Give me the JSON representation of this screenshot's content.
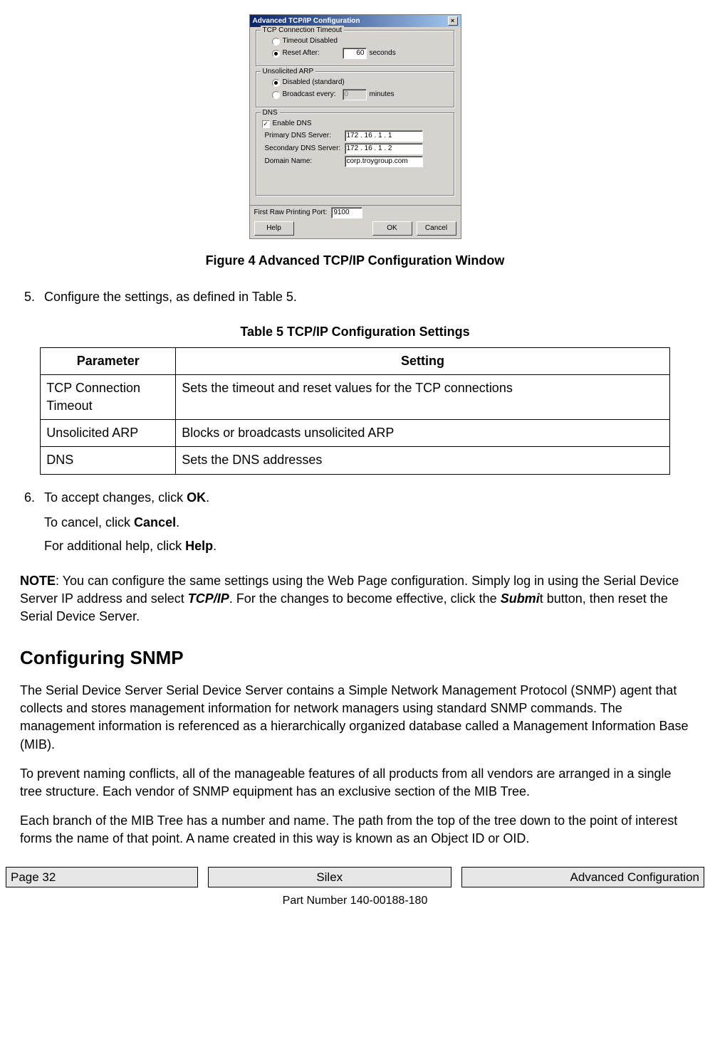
{
  "dialog": {
    "title": "Advanced TCP/IP Configuration",
    "tcpGroup": {
      "title": "TCP Connection Timeout",
      "opt1": "Timeout Disabled",
      "opt2": "Reset After:",
      "value": "60",
      "unit": "seconds"
    },
    "arpGroup": {
      "title": "Unsolicited ARP",
      "opt1": "Disabled (standard)",
      "opt2": "Broadcast every:",
      "value": "0",
      "unit": "minutes"
    },
    "dnsGroup": {
      "title": "DNS",
      "enable": "Enable DNS",
      "primaryLabel": "Primary DNS Server:",
      "primaryVal": "172 . 16 .  1  .  1",
      "secondaryLabel": "Secondary DNS Server:",
      "secondaryVal": "172 . 16 .  1  .  2",
      "domainLabel": "Domain Name:",
      "domainVal": "corp.troygroup.com"
    },
    "rawLabel": "First Raw Printing Port:",
    "rawVal": "9100",
    "helpBtn": "Help",
    "okBtn": "OK",
    "cancelBtn": "Cancel"
  },
  "fig": "Figure 4  Advanced TCP/IP Configuration Window",
  "step5": "Configure the settings, as defined in Table 5.",
  "tableCaption": "Table 5  TCP/IP Configuration Settings",
  "table": {
    "h1": "Parameter",
    "h2": "Setting",
    "rows": [
      {
        "p": "TCP Connection Timeout",
        "s": "Sets the timeout and reset values for the TCP connections"
      },
      {
        "p": "Unsolicited ARP",
        "s": "Blocks or broadcasts unsolicited ARP"
      },
      {
        "p": "DNS",
        "s": "Sets the DNS addresses"
      }
    ]
  },
  "step6": {
    "line1a": "To accept changes, click ",
    "line1b": "OK",
    "line1c": ".",
    "line2a": "To cancel, click ",
    "line2b": "Cancel",
    "line2c": ".",
    "line3a": "For additional help, click ",
    "line3b": "Help",
    "line3c": "."
  },
  "note": {
    "label": "NOTE",
    "t1": ":  You can configure the same settings using the Web Page configuration.  Simply log in using the Serial Device Server IP address and select ",
    "b1": "TCP/IP",
    "t2": ".  For the changes to become effective, click the ",
    "b2": "Submi",
    "t3": "t button, then reset the Serial Device Server."
  },
  "h2": "Configuring SNMP",
  "p1": "The Serial Device Server Serial Device Server contains a Simple Network Management Protocol (SNMP) agent that collects and stores management information for network managers using standard SNMP commands. The management information is referenced as a hierarchically organized database called a Management Information Base (MIB).",
  "p2": "To prevent naming conflicts, all of the manageable features of all products from all vendors are arranged in a single tree structure. Each vendor of SNMP equipment has an exclusive section of the MIB Tree.",
  "p3": "Each branch of the MIB Tree has a number and name. The path from the top of the tree down to the point of interest forms the name of that point. A name created in this way is known as an Object ID or OID.",
  "footer": {
    "page": "Page 32",
    "brand": "Silex",
    "section": "Advanced Configuration",
    "part": "Part Number 140-00188-180"
  }
}
